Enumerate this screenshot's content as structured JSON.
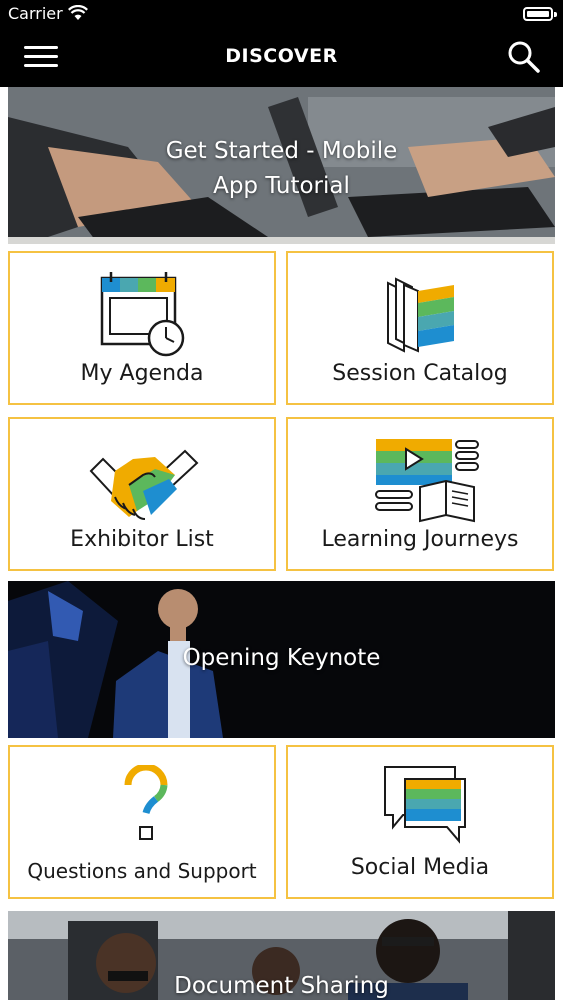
{
  "status_bar": {
    "carrier": "Carrier"
  },
  "nav": {
    "title": "DISCOVER",
    "menu_icon": "hamburger-menu-icon",
    "search_icon": "search-icon"
  },
  "banners": {
    "tutorial": {
      "line1": "Get Started - Mobile",
      "line2": "App Tutorial"
    },
    "keynote": {
      "label": "Opening Keynote"
    },
    "documents": {
      "label": "Document Sharing"
    }
  },
  "tiles": {
    "my_agenda": {
      "label": "My Agenda",
      "icon": "calendar-clock-icon"
    },
    "session_catalog": {
      "label": "Session Catalog",
      "icon": "book-icon"
    },
    "exhibitor_list": {
      "label": "Exhibitor List",
      "icon": "handshake-icon"
    },
    "learning_journeys": {
      "label": "Learning Journeys",
      "icon": "video-book-icon"
    },
    "questions_support": {
      "label": "Questions and Support",
      "icon": "question-mark-icon"
    },
    "social_media": {
      "label": "Social Media",
      "icon": "chat-bubbles-icon"
    }
  },
  "colors": {
    "tile_border": "#f5c242",
    "accent_blue": "#1e8ed0",
    "accent_green": "#5cb85c",
    "accent_gold": "#f0ab00",
    "accent_teal": "#4aa7b0"
  }
}
